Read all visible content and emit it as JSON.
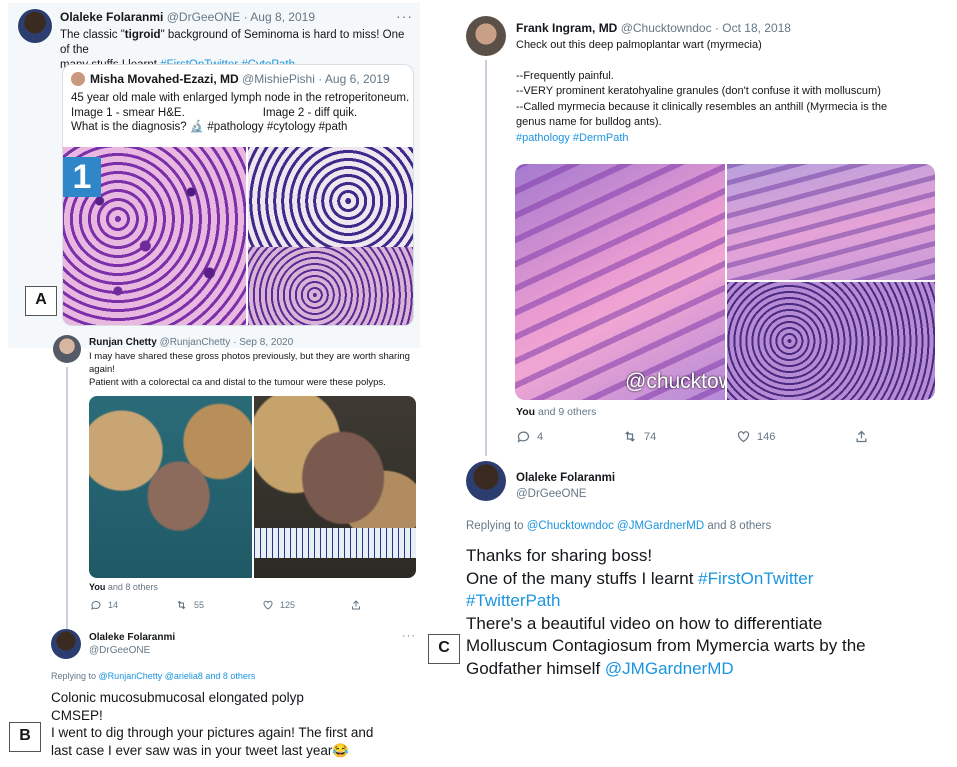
{
  "panelA": {
    "label": "A",
    "tweet": {
      "name": "Olaleke Folaranmi",
      "handle": "@DrGeeONE",
      "date": "· Aug 8, 2019",
      "text_pre": "The classic \"",
      "text_bold": "tigroid",
      "text_post": "\" background of Seminoma is hard to miss! One of the",
      "text_line2": "many stuffs I learnt",
      "tag1": "#FirstOnTwitter",
      "tag2": "#CytoPath",
      "more": "···"
    },
    "quote": {
      "name": "Misha Movahed-Ezazi, MD",
      "handle": "@MishiePishi",
      "date": "· Aug 6, 2019",
      "line1": "45 year old male with enlarged lymph node in the retroperitoneum.",
      "line2a": "Image 1 - smear H&E.",
      "line2b": "Image 2 - diff quik.",
      "line3": "What is the diagnosis? 🔬 #pathology #cytology #path",
      "image_number": "1"
    }
  },
  "panelB": {
    "label": "B",
    "tweet": {
      "name": "Runjan Chetty",
      "handle": "@RunjanChetty",
      "date": "· Sep 8, 2020",
      "line1": "I may have shared these gross photos previously, but they are worth sharing",
      "line2": "again!",
      "line3": "Patient with a colorectal ca and distal to the tumour were these polyps.",
      "likes_line_you": "You",
      "likes_line_rest": "and 8 others",
      "replies": "14",
      "retweets": "55",
      "likes": "125"
    },
    "reply": {
      "name": "Olaleke Folaranmi",
      "handle": "@DrGeeONE",
      "more": "···",
      "replying_prefix": "Replying to",
      "replying_handles": "@RunjanChetty @arielia8",
      "replying_suffix": "and 8 others",
      "line1": "Colonic mucosubmucosal elongated polyp",
      "line2": "CMSEP!",
      "line3": "I went to dig through your pictures again! The first and",
      "line4": "last case I ever saw was in your tweet last year😂"
    }
  },
  "panelC": {
    "label": "C",
    "tweet": {
      "name": "Frank Ingram, MD",
      "handle": "@Chucktowndoc",
      "date": "· Oct 18, 2018",
      "line1": "Check out this deep palmoplantar wart (myrmecia)",
      "line2": "--Frequently painful.",
      "line3": "--VERY prominent keratohyaline granules (don't confuse it with molluscum)",
      "line4": "--Called myrmecia because it clinically resembles an anthill (Myrmecia is the",
      "line5": "genus name for bulldog ants).",
      "tags": "#pathology #DermPath",
      "watermark": "@chucktow",
      "likes_line_you": "You",
      "likes_line_rest": "and 9 others",
      "replies": "4",
      "retweets": "74",
      "likes": "146"
    },
    "reply": {
      "name": "Olaleke Folaranmi",
      "handle": "@DrGeeONE",
      "replying_prefix": "Replying to",
      "replying_handles": "@Chucktowndoc @JMGardnerMD",
      "replying_suffix": "and 8 others",
      "line1": "Thanks for sharing boss!",
      "line2_pre": "One of the many stuffs I learnt",
      "line2_tag": "#FirstOnTwitter",
      "line3_tag": "#TwitterPath",
      "line4": "There's a beautiful video on how to differentiate",
      "line5": "Molluscum Contagiosum from Mymercia warts by the",
      "line6_pre": "Godfather himself",
      "line6_tag": "@JMGardnerMD"
    }
  },
  "colors": {
    "link": "#1b95e0",
    "muted": "#657786",
    "he_purple": "#8a3fb0",
    "he_pink": "#e6a0cf"
  }
}
